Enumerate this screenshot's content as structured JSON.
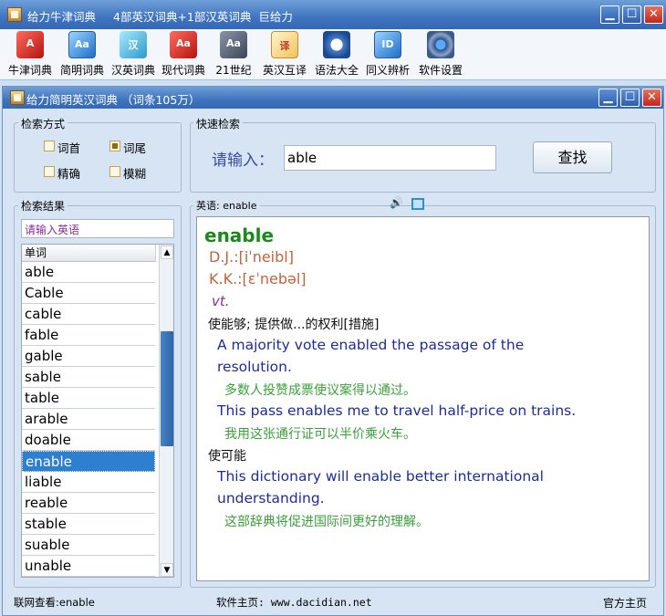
{
  "window": {
    "title": "给力牛津词典",
    "subtitle": "4部英汉词典+1部汉英词典  巨给力",
    "btn_min": "▁",
    "btn_max": "☐",
    "btn_close": "✕"
  },
  "toolbar": {
    "items": [
      {
        "label": "牛津词典",
        "icon": "oxford-dict-icon",
        "glyph": "A"
      },
      {
        "label": "简明词典",
        "icon": "concise-dict-icon",
        "glyph": "Aa"
      },
      {
        "label": "汉英词典",
        "icon": "cn-en-dict-icon",
        "glyph": "汉"
      },
      {
        "label": "现代词典",
        "icon": "modern-dict-icon",
        "glyph": "Aa"
      },
      {
        "label": "21世纪",
        "icon": "century21-dict-icon",
        "glyph": "Aa"
      },
      {
        "label": "英汉互译",
        "icon": "translate-icon",
        "glyph": "译"
      },
      {
        "label": "语法大全",
        "icon": "grammar-compass-icon",
        "glyph": ""
      },
      {
        "label": "同义辨析",
        "icon": "synonym-icon",
        "glyph": "ID"
      },
      {
        "label": "软件设置",
        "icon": "settings-gear-icon",
        "glyph": ""
      }
    ]
  },
  "inner": {
    "title": "给力简明英汉词典 （词条105万）",
    "search_mode": {
      "label": "检索方式",
      "options": [
        {
          "label": "词首",
          "checked": false
        },
        {
          "label": "词尾",
          "checked": true
        },
        {
          "label": "精确",
          "checked": false
        },
        {
          "label": "模糊",
          "checked": false
        }
      ]
    },
    "quick_search": {
      "label": "快速检索",
      "prompt": "请输入：",
      "value": "able",
      "button": "查找"
    },
    "results": {
      "label": "检索结果",
      "filter_placeholder": "请输入英语",
      "column_header": "单词",
      "words": [
        "able",
        "Cable",
        "cable",
        "fable",
        "gable",
        "sable",
        "table",
        "arable",
        "doable",
        "enable",
        "liable",
        "reable",
        "stable",
        "suable",
        "unable"
      ],
      "selected": "enable"
    },
    "definition": {
      "label": "英语: enable",
      "headword": "enable",
      "dj": "D.J.:[iˈneibl]",
      "kk": "K.K.:[ɛˈnebəl]",
      "pos": "vt.",
      "senses": [
        {
          "meaning": "使能够; 提供做...的权利[措施]",
          "examples": [
            {
              "en_line1": "A majority vote enabled the passage of the",
              "en_line2": "resolution.",
              "zh": "多数人投赞成票使议案得以通过。"
            },
            {
              "en_line1": "This pass enables me to travel half-price on trains.",
              "en_line2": "",
              "zh": "我用这张通行证可以半价乘火车。"
            }
          ]
        },
        {
          "meaning": "使可能",
          "examples": [
            {
              "en_line1": "This dictionary will enable better international",
              "en_line2": "understanding.",
              "zh": "这部辞典将促进国际间更好的理解。"
            }
          ]
        }
      ]
    },
    "status": {
      "online_lookup": "联网查看:enable",
      "homepage": "软件主页: www.dacidian.net",
      "official": "官方主页"
    }
  },
  "colors": {
    "headword": "#1a8a1a",
    "phonetic": "#c0643a",
    "pos": "#8a2c9a",
    "example_en": "#1c2c9e",
    "example_zh": "#3aa03a",
    "selection": "#2f7fd0"
  }
}
